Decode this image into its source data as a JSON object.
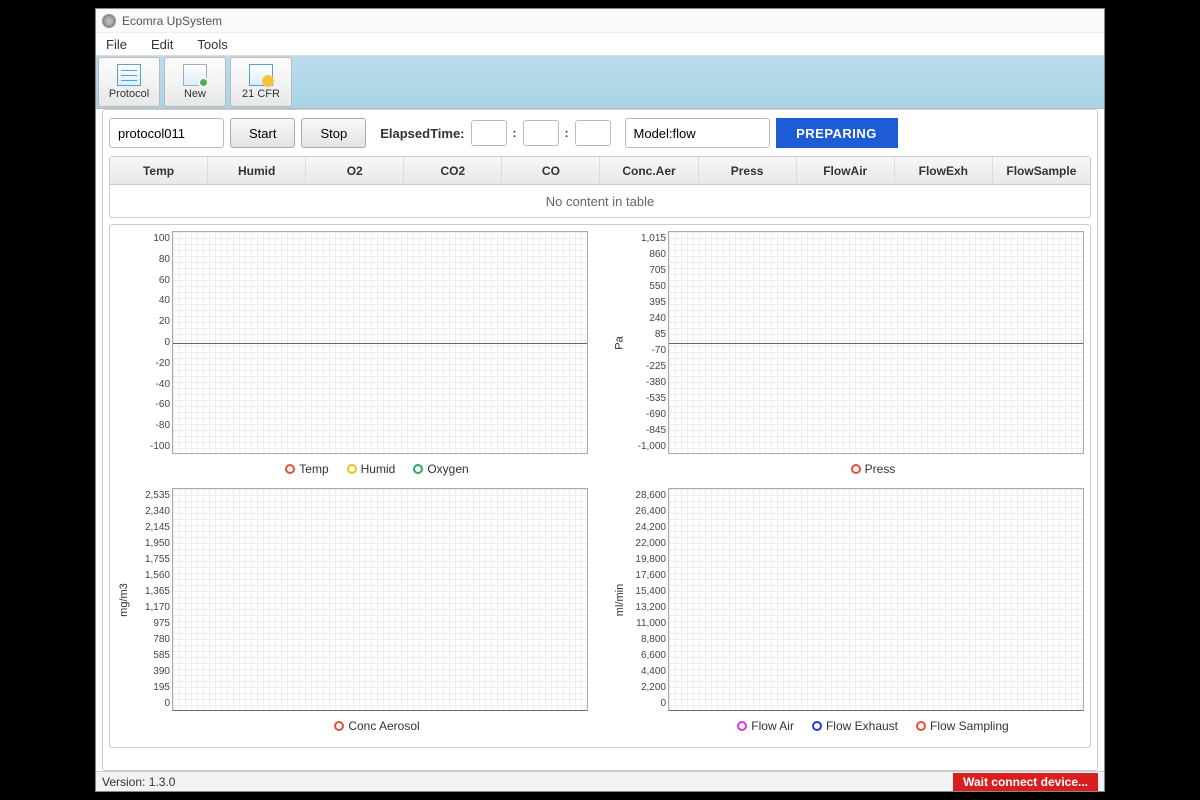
{
  "app": {
    "title": "Ecomra UpSystem"
  },
  "menu": {
    "file": "File",
    "edit": "Edit",
    "tools": "Tools"
  },
  "toolbar": {
    "protocol": "Protocol",
    "new": "New",
    "cfr": "21 CFR"
  },
  "controls": {
    "protocol_name": "protocol011",
    "start": "Start",
    "stop": "Stop",
    "elapsed_label": "ElapsedTime:",
    "elapsed_h": "",
    "elapsed_m": "",
    "elapsed_s": "",
    "model": "Model:flow",
    "status": "PREPARING"
  },
  "table": {
    "columns": [
      "Temp",
      "Humid",
      "O2",
      "CO2",
      "CO",
      "Conc.Aer",
      "Press",
      "FlowAir",
      "FlowExh",
      "FlowSample"
    ],
    "empty_msg": "No content in table"
  },
  "charts": [
    {
      "ylabel": "",
      "yticks": [
        "100",
        "80",
        "60",
        "40",
        "20",
        "0",
        "-20",
        "-40",
        "-60",
        "-80",
        "-100"
      ],
      "zero_pct": 50,
      "legend": [
        {
          "name": "Temp",
          "color": "#e74c3c"
        },
        {
          "name": "Humid",
          "color": "#f1c40f"
        },
        {
          "name": "Oxygen",
          "color": "#27ae60"
        }
      ]
    },
    {
      "ylabel": "Pa",
      "yticks": [
        "1,015",
        "860",
        "705",
        "550",
        "395",
        "240",
        "85",
        "-70",
        "-225",
        "-380",
        "-535",
        "-690",
        "-845",
        "-1,000"
      ],
      "zero_pct": 50,
      "legend": [
        {
          "name": "Press",
          "color": "#e74c3c"
        }
      ]
    },
    {
      "ylabel": "mg/m3",
      "yticks": [
        "2,535",
        "2,340",
        "2,145",
        "1,950",
        "1,755",
        "1,560",
        "1,365",
        "1,170",
        "975",
        "780",
        "585",
        "390",
        "195",
        "0"
      ],
      "zero_pct": 100,
      "legend": [
        {
          "name": "Conc Aerosol",
          "color": "#e74c3c"
        }
      ]
    },
    {
      "ylabel": "ml/min",
      "yticks": [
        "28,600",
        "26,400",
        "24,200",
        "22,000",
        "19,800",
        "17,600",
        "15,400",
        "13,200",
        "11,000",
        "8,800",
        "6,600",
        "4,400",
        "2,200",
        "0"
      ],
      "zero_pct": 100,
      "legend": [
        {
          "name": "Flow Air",
          "color": "#d63ad6"
        },
        {
          "name": "Flow Exhaust",
          "color": "#1e3fd6"
        },
        {
          "name": "Flow Sampling",
          "color": "#e74c3c"
        }
      ]
    }
  ],
  "statusbar": {
    "version": "Version: 1.3.0",
    "connect": "Wait connect device..."
  },
  "chart_data": [
    {
      "type": "line",
      "series": [
        {
          "name": "Temp",
          "values": []
        },
        {
          "name": "Humid",
          "values": []
        },
        {
          "name": "Oxygen",
          "values": []
        }
      ],
      "ylim": [
        -100,
        100
      ],
      "ylabel": ""
    },
    {
      "type": "line",
      "series": [
        {
          "name": "Press",
          "values": []
        }
      ],
      "ylim": [
        -1000,
        1015
      ],
      "ylabel": "Pa"
    },
    {
      "type": "line",
      "series": [
        {
          "name": "Conc Aerosol",
          "values": []
        }
      ],
      "ylim": [
        0,
        2535
      ],
      "ylabel": "mg/m3"
    },
    {
      "type": "line",
      "series": [
        {
          "name": "Flow Air",
          "values": []
        },
        {
          "name": "Flow Exhaust",
          "values": []
        },
        {
          "name": "Flow Sampling",
          "values": []
        }
      ],
      "ylim": [
        0,
        28600
      ],
      "ylabel": "ml/min"
    }
  ]
}
